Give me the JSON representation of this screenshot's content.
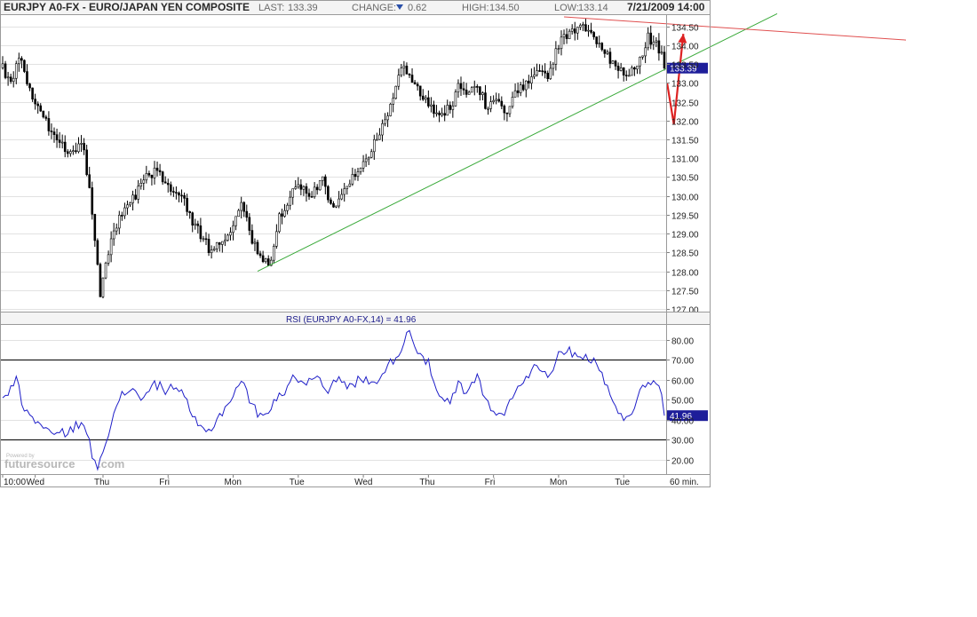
{
  "header": {
    "title": "EURJPY A0-FX - EURO/JAPAN YEN COMPOSITE",
    "last_label": "LAST:",
    "last_value": "133.39",
    "change_label": "CHANGE:",
    "change_value": "0.62",
    "high_label": "HIGH:",
    "high_value": "134.50",
    "low_label": "LOW:",
    "low_value": "133.14",
    "datetime": "7/21/2009 14:00"
  },
  "colors": {
    "bg": "#ffffff",
    "grid": "#e2e2e2",
    "axis": "#808080",
    "candle": "#000000",
    "rsi": "#1e1ec8",
    "marker_bg": "#1e1e9a",
    "trend_green": "#3aaa3a",
    "trend_red": "#e05050",
    "arrow_red": "#dd2222",
    "watermark": "#b8b8b8",
    "change_arrow": "#2a4fa8"
  },
  "chart_data": [
    {
      "type": "candlestick",
      "title": "EURJPY A0-FX - EURO/JAPAN YEN COMPOSITE",
      "ylim": [
        127.0,
        134.75
      ],
      "y_ticks": [
        127.0,
        127.5,
        128.0,
        128.5,
        129.0,
        129.5,
        130.0,
        130.5,
        131.0,
        131.5,
        132.0,
        132.5,
        133.0,
        133.5,
        134.0,
        134.5
      ],
      "y_tick_labels": [
        "127.00",
        "127.50",
        "128.00",
        "128.50",
        "129.00",
        "129.50",
        "130.00",
        "130.50",
        "131.00",
        "131.50",
        "132.00",
        "132.50",
        "133.00",
        "133.50",
        "134.00",
        "134.50"
      ],
      "x_labels": [
        "10:00",
        "Wed",
        "Thu",
        "Fri",
        "Mon",
        "Tue",
        "Wed",
        "Thu",
        "Fri",
        "Mon",
        "Tue"
      ],
      "x_label_pos": [
        0,
        12,
        37,
        61,
        85,
        109,
        133,
        157,
        181,
        205,
        229
      ],
      "n_bars": 245,
      "last_price": 133.39,
      "last_price_label": "133.39",
      "close_anchors": [
        [
          0,
          133.4
        ],
        [
          3,
          133.0
        ],
        [
          6,
          133.7
        ],
        [
          12,
          132.5
        ],
        [
          18,
          131.7
        ],
        [
          24,
          131.2
        ],
        [
          30,
          131.3
        ],
        [
          33,
          129.5
        ],
        [
          35,
          128.1
        ],
        [
          36,
          127.4
        ],
        [
          38,
          128.3
        ],
        [
          41,
          129.0
        ],
        [
          44,
          129.6
        ],
        [
          48,
          129.9
        ],
        [
          52,
          130.4
        ],
        [
          57,
          130.7
        ],
        [
          61,
          130.2
        ],
        [
          66,
          130.0
        ],
        [
          71,
          129.2
        ],
        [
          76,
          128.6
        ],
        [
          80,
          128.8
        ],
        [
          84,
          129.1
        ],
        [
          88,
          129.8
        ],
        [
          92,
          128.8
        ],
        [
          96,
          128.2
        ],
        [
          99,
          128.3
        ],
        [
          102,
          129.4
        ],
        [
          106,
          130.0
        ],
        [
          110,
          130.3
        ],
        [
          114,
          130.0
        ],
        [
          118,
          130.4
        ],
        [
          122,
          129.6
        ],
        [
          126,
          130.3
        ],
        [
          130,
          130.6
        ],
        [
          134,
          131.0
        ],
        [
          138,
          131.6
        ],
        [
          142,
          132.1
        ],
        [
          144,
          132.7
        ],
        [
          147,
          133.5
        ],
        [
          150,
          133.1
        ],
        [
          153,
          132.8
        ],
        [
          157,
          132.4
        ],
        [
          161,
          132.2
        ],
        [
          165,
          132.3
        ],
        [
          168,
          132.9
        ],
        [
          171,
          132.7
        ],
        [
          175,
          133.0
        ],
        [
          178,
          132.4
        ],
        [
          182,
          132.5
        ],
        [
          186,
          132.1
        ],
        [
          189,
          132.7
        ],
        [
          193,
          133.0
        ],
        [
          197,
          133.4
        ],
        [
          201,
          133.2
        ],
        [
          205,
          134.0
        ],
        [
          209,
          134.3
        ],
        [
          212,
          134.5
        ],
        [
          215,
          134.4
        ],
        [
          218,
          134.2
        ],
        [
          222,
          133.8
        ],
        [
          226,
          133.5
        ],
        [
          229,
          133.2
        ],
        [
          232,
          133.3
        ],
        [
          235,
          133.6
        ],
        [
          238,
          134.2
        ],
        [
          241,
          134.0
        ],
        [
          243,
          133.8
        ],
        [
          244,
          133.39
        ]
      ],
      "trendline_green": [
        [
          94,
          128.0
        ],
        [
          244,
          133.35
        ]
      ],
      "trendline_red": [
        [
          207,
          134.75
        ],
        [
          246,
          134.56
        ]
      ],
      "projection_arrow": [
        [
          245,
          133.0
        ],
        [
          247.5,
          131.9
        ],
        [
          251,
          134.3
        ]
      ]
    },
    {
      "type": "line",
      "title": "RSI (EURJPY A0-FX,14) = 41.96",
      "ylim": [
        14,
        87
      ],
      "y_ticks": [
        20,
        30,
        40,
        50,
        60,
        70,
        80
      ],
      "y_tick_labels": [
        "20.00",
        "30.00",
        "40.00",
        "50.00",
        "60.00",
        "70.00",
        "80.00"
      ],
      "reference_lines": [
        30,
        70
      ],
      "last_value": 41.96,
      "last_value_label": "41.96",
      "anchors": [
        [
          0,
          50
        ],
        [
          3,
          56
        ],
        [
          5,
          61
        ],
        [
          8,
          44
        ],
        [
          12,
          40
        ],
        [
          16,
          35
        ],
        [
          20,
          32
        ],
        [
          24,
          34
        ],
        [
          28,
          38
        ],
        [
          31,
          34
        ],
        [
          33,
          22
        ],
        [
          35,
          17
        ],
        [
          37,
          26
        ],
        [
          40,
          38
        ],
        [
          44,
          52
        ],
        [
          48,
          56
        ],
        [
          52,
          50
        ],
        [
          56,
          58
        ],
        [
          60,
          55
        ],
        [
          64,
          57
        ],
        [
          68,
          48
        ],
        [
          72,
          36
        ],
        [
          76,
          34
        ],
        [
          80,
          42
        ],
        [
          84,
          50
        ],
        [
          88,
          60
        ],
        [
          92,
          47
        ],
        [
          96,
          40
        ],
        [
          100,
          50
        ],
        [
          104,
          54
        ],
        [
          108,
          62
        ],
        [
          112,
          58
        ],
        [
          116,
          63
        ],
        [
          120,
          55
        ],
        [
          124,
          60
        ],
        [
          128,
          56
        ],
        [
          132,
          61
        ],
        [
          136,
          58
        ],
        [
          140,
          63
        ],
        [
          144,
          70
        ],
        [
          147,
          76
        ],
        [
          150,
          85
        ],
        [
          153,
          75
        ],
        [
          157,
          68
        ],
        [
          161,
          50
        ],
        [
          165,
          48
        ],
        [
          168,
          58
        ],
        [
          171,
          52
        ],
        [
          175,
          62
        ],
        [
          178,
          50
        ],
        [
          182,
          42
        ],
        [
          186,
          45
        ],
        [
          189,
          56
        ],
        [
          193,
          60
        ],
        [
          197,
          68
        ],
        [
          201,
          62
        ],
        [
          205,
          72
        ],
        [
          209,
          74
        ],
        [
          212,
          73
        ],
        [
          215,
          72
        ],
        [
          218,
          69
        ],
        [
          222,
          60
        ],
        [
          226,
          48
        ],
        [
          229,
          38
        ],
        [
          232,
          44
        ],
        [
          235,
          55
        ],
        [
          238,
          60
        ],
        [
          241,
          58
        ],
        [
          243,
          52
        ],
        [
          244,
          41.96
        ]
      ]
    }
  ],
  "axis_unit": "60 min.",
  "watermark": {
    "small": "Powered by",
    "brand": "futuresource",
    "tld": ".com"
  }
}
